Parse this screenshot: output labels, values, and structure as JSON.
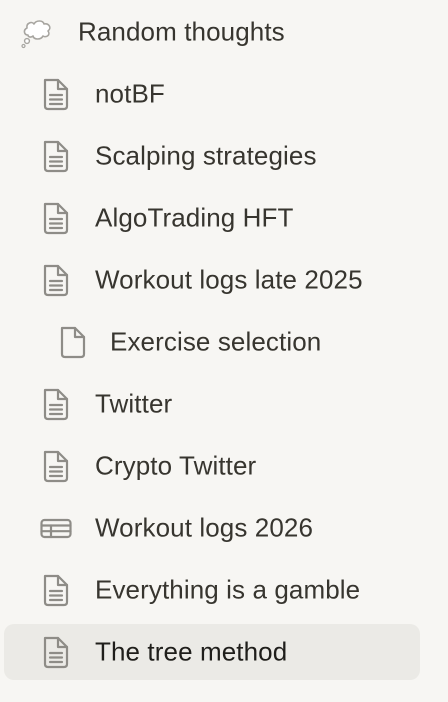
{
  "sidebar": {
    "items": [
      {
        "label": "Random thoughts",
        "icon": "thought-bubble-icon"
      },
      {
        "label": "notBF",
        "icon": "page-icon"
      },
      {
        "label": "Scalping strategies",
        "icon": "page-icon"
      },
      {
        "label": "AlgoTrading HFT",
        "icon": "page-icon"
      },
      {
        "label": "Workout logs late 2025",
        "icon": "page-icon"
      },
      {
        "label": "Exercise selection",
        "icon": "blank-page-icon"
      },
      {
        "label": "Twitter",
        "icon": "page-icon"
      },
      {
        "label": "Crypto Twitter",
        "icon": "page-icon"
      },
      {
        "label": "Workout logs 2026",
        "icon": "table-icon"
      },
      {
        "label": "Everything is a gamble",
        "icon": "page-icon"
      },
      {
        "label": "The tree method",
        "icon": "page-icon",
        "selected": true
      }
    ]
  },
  "colors": {
    "background": "#f7f6f3",
    "selected_row": "#ebeae6",
    "text": "#37352f",
    "icon": "#8e8c87"
  }
}
